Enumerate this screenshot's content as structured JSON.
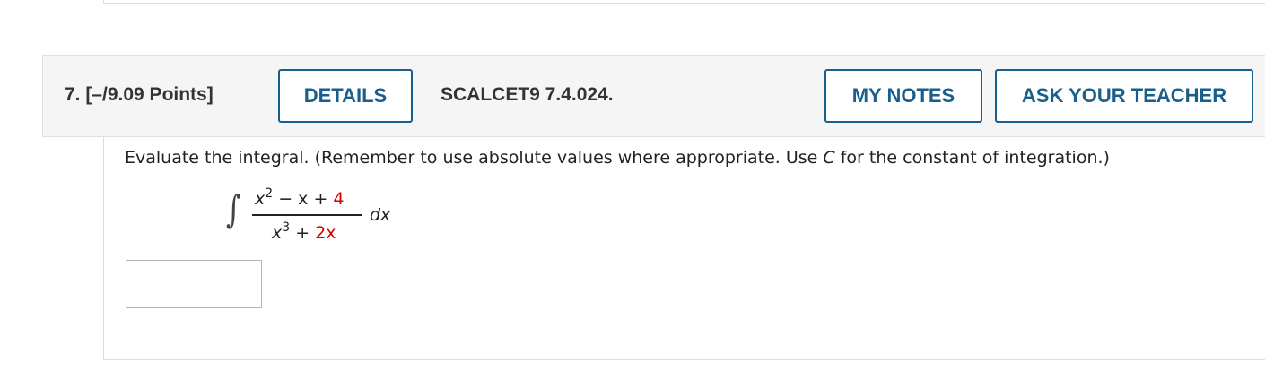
{
  "question": {
    "number_points": "7. [–/9.09 Points]",
    "details_label": "DETAILS",
    "code": "SCALCET9 7.4.024.",
    "my_notes_label": "MY NOTES",
    "ask_teacher_label": "ASK YOUR TEACHER",
    "instructions_before": "Evaluate the integral. (Remember to use absolute values where appropriate. Use ",
    "instructions_var": "C",
    "instructions_after": " for the constant of integration.)",
    "integral": {
      "sign": "∫",
      "num_x": "x",
      "num_exp": "2",
      "num_mid": " − x + ",
      "num_const": "4",
      "den_x": "x",
      "den_exp": "3",
      "den_plus": " + ",
      "den_coef": "2x",
      "dx": "dx"
    },
    "answer": {
      "value": ""
    }
  },
  "colors": {
    "button_accent": "#1a5f8c",
    "highlight_red": "#d40000",
    "header_bg": "#f5f5f5"
  }
}
